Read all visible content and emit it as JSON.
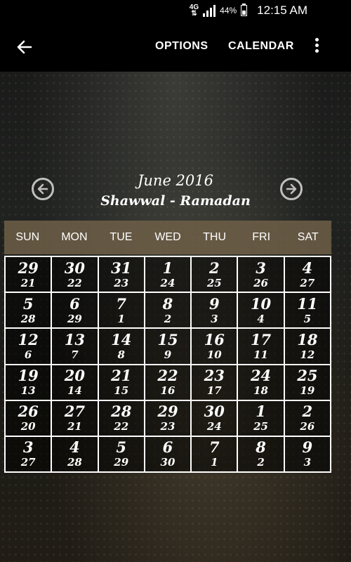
{
  "status_bar": {
    "network": "4G",
    "battery": "44%",
    "time": "12:15 AM",
    "icons": [
      "signal-icon",
      "battery-icon"
    ]
  },
  "app_bar": {
    "back_icon": "arrow-left-icon",
    "options_label": "OPTIONS",
    "calendar_label": "CALENDAR",
    "overflow_icon": "more-vert-icon"
  },
  "header": {
    "month": "June 2016",
    "hijri": "Shawwal - Ramadan",
    "prev_icon": "circle-arrow-left-icon",
    "next_icon": "circle-arrow-right-icon"
  },
  "weekdays": [
    "SUN",
    "MON",
    "TUE",
    "WED",
    "THU",
    "FRI",
    "SAT"
  ],
  "weeks": [
    [
      [
        "29",
        "21"
      ],
      [
        "30",
        "22"
      ],
      [
        "31",
        "23"
      ],
      [
        "1",
        "24"
      ],
      [
        "2",
        "25"
      ],
      [
        "3",
        "26"
      ],
      [
        "4",
        "27"
      ]
    ],
    [
      [
        "5",
        "28"
      ],
      [
        "6",
        "29"
      ],
      [
        "7",
        "1"
      ],
      [
        "8",
        "2"
      ],
      [
        "9",
        "3"
      ],
      [
        "10",
        "4"
      ],
      [
        "11",
        "5"
      ]
    ],
    [
      [
        "12",
        "6"
      ],
      [
        "13",
        "7"
      ],
      [
        "14",
        "8"
      ],
      [
        "15",
        "9"
      ],
      [
        "16",
        "10"
      ],
      [
        "17",
        "11"
      ],
      [
        "18",
        "12"
      ]
    ],
    [
      [
        "19",
        "13"
      ],
      [
        "20",
        "14"
      ],
      [
        "21",
        "15"
      ],
      [
        "22",
        "16"
      ],
      [
        "23",
        "17"
      ],
      [
        "24",
        "18"
      ],
      [
        "25",
        "19"
      ]
    ],
    [
      [
        "26",
        "20"
      ],
      [
        "27",
        "21"
      ],
      [
        "28",
        "22"
      ],
      [
        "29",
        "23"
      ],
      [
        "30",
        "24"
      ],
      [
        "1",
        "25"
      ],
      [
        "2",
        "26"
      ]
    ],
    [
      [
        "3",
        "27"
      ],
      [
        "4",
        "28"
      ],
      [
        "5",
        "29"
      ],
      [
        "6",
        "30"
      ],
      [
        "7",
        "1"
      ],
      [
        "8",
        "2"
      ],
      [
        "9",
        "3"
      ]
    ]
  ],
  "colors": {
    "weekday_bar": "#6e5f48",
    "grid_line": "#ffffff"
  }
}
